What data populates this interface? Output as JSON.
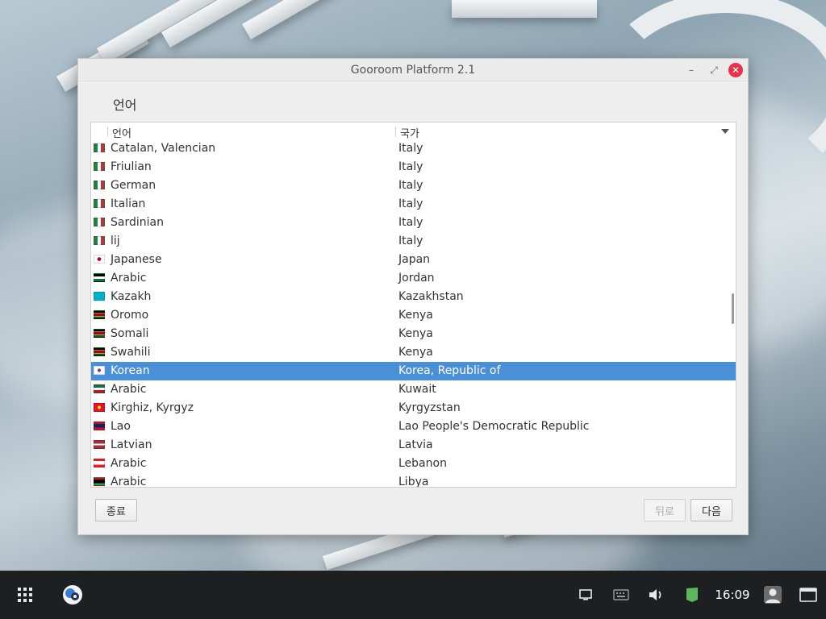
{
  "window": {
    "title": "Gooroom Platform 2.1",
    "controls": {
      "minimize": "–",
      "maximize": "⤢",
      "close": "✕"
    }
  },
  "page": {
    "heading": "언어"
  },
  "list": {
    "columns": {
      "language": "언어",
      "country": "국가"
    },
    "rows": [
      {
        "language": "Catalan, Valencian",
        "country": "Italy",
        "flag": "it"
      },
      {
        "language": "Friulian",
        "country": "Italy",
        "flag": "it"
      },
      {
        "language": "German",
        "country": "Italy",
        "flag": "it"
      },
      {
        "language": "Italian",
        "country": "Italy",
        "flag": "it"
      },
      {
        "language": "Sardinian",
        "country": "Italy",
        "flag": "it"
      },
      {
        "language": "lij",
        "country": "Italy",
        "flag": "it"
      },
      {
        "language": "Japanese",
        "country": "Japan",
        "flag": "jp"
      },
      {
        "language": "Arabic",
        "country": "Jordan",
        "flag": "jo"
      },
      {
        "language": "Kazakh",
        "country": "Kazakhstan",
        "flag": "kz"
      },
      {
        "language": "Oromo",
        "country": "Kenya",
        "flag": "ke"
      },
      {
        "language": "Somali",
        "country": "Kenya",
        "flag": "ke"
      },
      {
        "language": "Swahili",
        "country": "Kenya",
        "flag": "ke"
      },
      {
        "language": "Korean",
        "country": "Korea, Republic of",
        "flag": "kr",
        "selected": true
      },
      {
        "language": "Arabic",
        "country": "Kuwait",
        "flag": "kw"
      },
      {
        "language": "Kirghiz, Kyrgyz",
        "country": "Kyrgyzstan",
        "flag": "kg"
      },
      {
        "language": "Lao",
        "country": "Lao People's Democratic Republic",
        "flag": "la"
      },
      {
        "language": "Latvian",
        "country": "Latvia",
        "flag": "lv"
      },
      {
        "language": "Arabic",
        "country": "Lebanon",
        "flag": "lb"
      },
      {
        "language": "Arabic",
        "country": "Libya",
        "flag": "ly"
      }
    ]
  },
  "buttons": {
    "quit": "종료",
    "back": "뒤로",
    "next": "다음"
  },
  "taskbar": {
    "clock": "16:09"
  },
  "colors": {
    "selection": "#4a90d9",
    "close": "#e8334a",
    "battery": "#5cb85c"
  }
}
